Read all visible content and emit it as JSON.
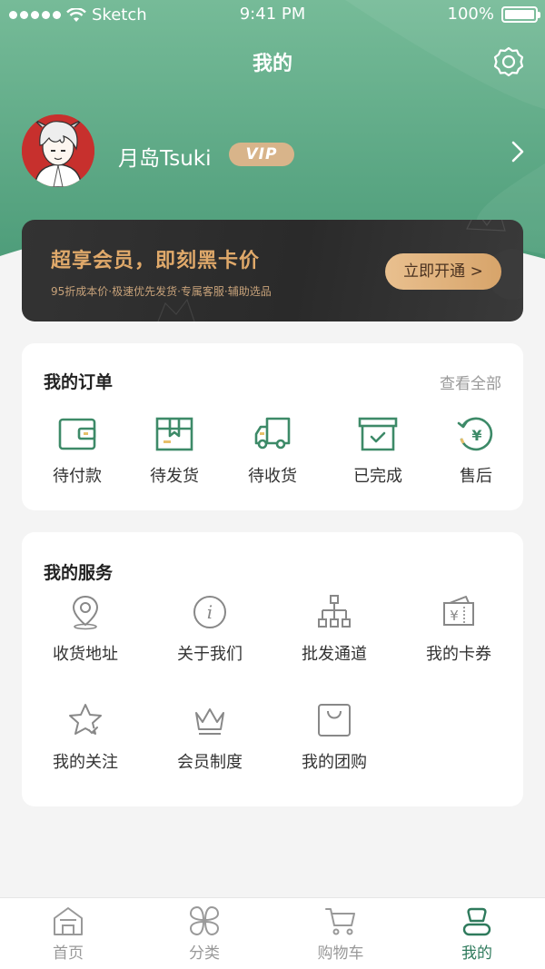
{
  "status_bar": {
    "carrier": "Sketch",
    "time": "9:41 PM",
    "battery": "100%"
  },
  "header": {
    "title": "我的"
  },
  "profile": {
    "name": "月岛Tsuki",
    "badge": "VIP"
  },
  "vip_card": {
    "title": "超享会员，即刻黑卡价",
    "subtitle": "95折成本价·极速优先发货·专属客服·辅助选品",
    "button": "立即开通 >"
  },
  "orders": {
    "title": "我的订单",
    "view_all": "查看全部",
    "items": [
      {
        "label": "待付款",
        "icon": "wallet-icon"
      },
      {
        "label": "待发货",
        "icon": "package-icon"
      },
      {
        "label": "待收货",
        "icon": "truck-icon"
      },
      {
        "label": "已完成",
        "icon": "box-check-icon"
      },
      {
        "label": "售后",
        "icon": "refund-icon"
      }
    ]
  },
  "services": {
    "title": "我的服务",
    "items": [
      {
        "label": "收货地址",
        "icon": "location-icon"
      },
      {
        "label": "关于我们",
        "icon": "info-icon"
      },
      {
        "label": "批发通道",
        "icon": "hierarchy-icon"
      },
      {
        "label": "我的卡券",
        "icon": "coupon-icon"
      },
      {
        "label": "我的关注",
        "icon": "star-icon"
      },
      {
        "label": "会员制度",
        "icon": "crown-icon"
      },
      {
        "label": "我的团购",
        "icon": "shopping-bag-icon"
      }
    ]
  },
  "tabbar": {
    "active": "我的",
    "items": [
      {
        "label": "首页",
        "icon": "home-icon"
      },
      {
        "label": "分类",
        "icon": "category-icon"
      },
      {
        "label": "购物车",
        "icon": "cart-icon"
      },
      {
        "label": "我的",
        "icon": "profile-icon"
      }
    ]
  },
  "colors": {
    "header_green": "#5aa685",
    "accent_green": "#2e7a5c",
    "icon_green": "#3d8a68",
    "vip_gold": "#d8b48a",
    "vip_card_dark": "#2e2e2e",
    "page_background": "#f4f4f4"
  }
}
